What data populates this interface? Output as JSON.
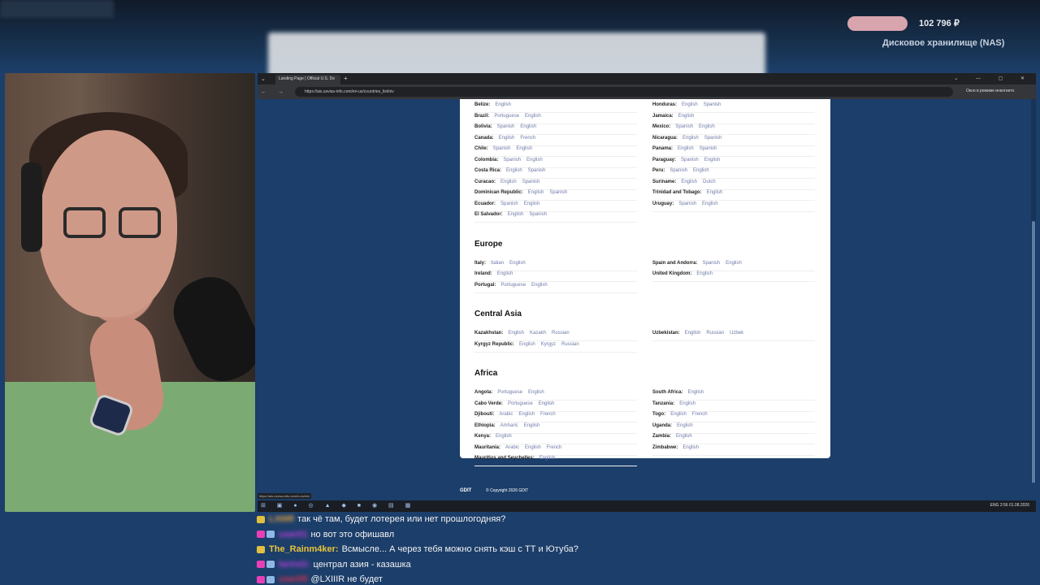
{
  "overlay": {
    "donation_amount": "102 796 ₽",
    "donation_goal": "Дисковое хранилище (NAS)"
  },
  "browser": {
    "tab_title": "Landing Page | Official U.S. De",
    "url": "https://ais.usvisa-info.com/en-us/countries_list/niv",
    "incognito_label": "Окно в режиме инкогнито"
  },
  "regions": [
    {
      "name": "",
      "left": [
        {
          "country": "Belize:",
          "langs": [
            "English"
          ]
        },
        {
          "country": "Brazil:",
          "langs": [
            "Portuguese",
            "English"
          ]
        },
        {
          "country": "Bolivia:",
          "langs": [
            "Spanish",
            "English"
          ]
        },
        {
          "country": "Canada:",
          "langs": [
            "English",
            "French"
          ]
        },
        {
          "country": "Chile:",
          "langs": [
            "Spanish",
            "English"
          ]
        },
        {
          "country": "Colombia:",
          "langs": [
            "Spanish",
            "English"
          ]
        },
        {
          "country": "Costa Rica:",
          "langs": [
            "English",
            "Spanish"
          ]
        },
        {
          "country": "Curacao:",
          "langs": [
            "English",
            "Spanish"
          ]
        },
        {
          "country": "Dominican Republic:",
          "langs": [
            "English",
            "Spanish"
          ]
        },
        {
          "country": "Ecuador:",
          "langs": [
            "Spanish",
            "English"
          ]
        },
        {
          "country": "El Salvador:",
          "langs": [
            "English",
            "Spanish"
          ]
        }
      ],
      "right": [
        {
          "country": "Honduras:",
          "langs": [
            "English",
            "Spanish"
          ]
        },
        {
          "country": "Jamaica:",
          "langs": [
            "English"
          ]
        },
        {
          "country": "Mexico:",
          "langs": [
            "Spanish",
            "English"
          ]
        },
        {
          "country": "Nicaragua:",
          "langs": [
            "English",
            "Spanish"
          ]
        },
        {
          "country": "Panama:",
          "langs": [
            "English",
            "Spanish"
          ]
        },
        {
          "country": "Paraguay:",
          "langs": [
            "Spanish",
            "English"
          ]
        },
        {
          "country": "Peru:",
          "langs": [
            "Spanish",
            "English"
          ]
        },
        {
          "country": "Suriname:",
          "langs": [
            "English",
            "Dutch"
          ]
        },
        {
          "country": "Trinidad and Tobago:",
          "langs": [
            "English"
          ]
        },
        {
          "country": "Uruguay:",
          "langs": [
            "Spanish",
            "English"
          ]
        }
      ]
    },
    {
      "name": "Europe",
      "left": [
        {
          "country": "Italy:",
          "langs": [
            "Italian",
            "English"
          ]
        },
        {
          "country": "Ireland:",
          "langs": [
            "English"
          ]
        },
        {
          "country": "Portugal:",
          "langs": [
            "Portuguese",
            "English"
          ]
        }
      ],
      "right": [
        {
          "country": "Spain and Andorra:",
          "langs": [
            "Spanish",
            "English"
          ]
        },
        {
          "country": "United Kingdom:",
          "langs": [
            "English"
          ]
        }
      ]
    },
    {
      "name": "Central Asia",
      "left": [
        {
          "country": "Kazakhstan:",
          "langs": [
            "English",
            "Kazakh",
            "Russian"
          ]
        },
        {
          "country": "Kyrgyz Republic:",
          "langs": [
            "English",
            "Kyrgyz",
            "Russian"
          ]
        }
      ],
      "right": [
        {
          "country": "Uzbekistan:",
          "langs": [
            "English",
            "Russian",
            "Uzbek"
          ]
        }
      ]
    },
    {
      "name": "Africa",
      "left": [
        {
          "country": "Angola:",
          "langs": [
            "Portuguese",
            "English"
          ]
        },
        {
          "country": "Cabo Verde:",
          "langs": [
            "Portuguese",
            "English"
          ]
        },
        {
          "country": "Djibouti:",
          "langs": [
            "Arabic",
            "English",
            "French"
          ]
        },
        {
          "country": "Ethiopia:",
          "langs": [
            "Amharic",
            "English"
          ]
        },
        {
          "country": "Kenya:",
          "langs": [
            "English"
          ]
        },
        {
          "country": "Mauritania:",
          "langs": [
            "Arabic",
            "English",
            "French"
          ]
        },
        {
          "country": "Mauritius and Seychelles:",
          "langs": [
            "English"
          ]
        }
      ],
      "right": [
        {
          "country": "South Africa:",
          "langs": [
            "English"
          ]
        },
        {
          "country": "Tanzania:",
          "langs": [
            "English"
          ]
        },
        {
          "country": "Togo:",
          "langs": [
            "English",
            "French"
          ]
        },
        {
          "country": "Uganda:",
          "langs": [
            "English"
          ]
        },
        {
          "country": "Zambia:",
          "langs": [
            "English"
          ]
        },
        {
          "country": "Zimbabwe:",
          "langs": [
            "English"
          ]
        }
      ]
    }
  ],
  "footer": {
    "logo": "GDIT",
    "copyright": "© Copyright 2026 GDIT"
  },
  "status_url": "https://ais.usvisa-info.com/ru-kz/niv",
  "tray": {
    "lang": "ENG",
    "time": "2:56",
    "date": "01.08.2026"
  },
  "chat": [
    {
      "badges": [
        "b-yellow"
      ],
      "nick": "LXIIIR",
      "nick_color": "#e8a23c",
      "blurred": true,
      "text": "так чё там, будет лотерея или нет прошлогодняя?"
    },
    {
      "badges": [
        "b-pink",
        "b-blue"
      ],
      "nick": "user01",
      "nick_color": "#c040e0",
      "blurred": true,
      "text": "но вот это офишавл"
    },
    {
      "badges": [
        "b-yellow"
      ],
      "nick": "The_Rainm4ker:",
      "nick_color": "#e8c23c",
      "blurred": false,
      "text": "Всмысле... А через тебя можно снять кэш с ТТ и Ютуба?"
    },
    {
      "badges": [
        "b-pink",
        "b-blue"
      ],
      "nick": "heVvO:",
      "nick_color": "#c040e0",
      "blurred": true,
      "text": "централ азия - казашка"
    },
    {
      "badges": [
        "b-pink",
        "b-blue"
      ],
      "nick": "user05",
      "nick_color": "#e03050",
      "blurred": true,
      "text": "@LXIIIR не будет"
    }
  ]
}
